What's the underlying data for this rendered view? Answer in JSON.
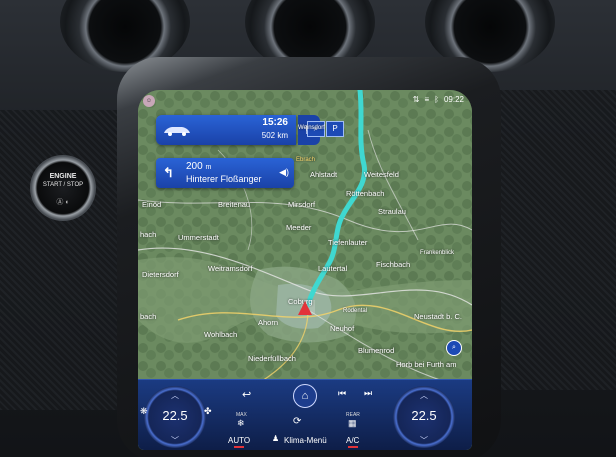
{
  "status": {
    "time": "09:22"
  },
  "route": {
    "eta": "15:26",
    "remaining": "502 km"
  },
  "guidance": {
    "distance": "200",
    "unit": "m",
    "street": "Hinterer Floßanger"
  },
  "map_labels": {
    "ebrach": "Ebrach",
    "ahlstadt": "Ahlstadt",
    "weitesfeld": "Weitesfeld",
    "roettenbach": "Röttenbach",
    "einod": "Einöd",
    "breitenau": "Breitenau",
    "mirsdorf": "Mirsdorf",
    "straulau": "Straulau",
    "hach": "hach",
    "ummerstadt": "Ummerstadt",
    "meeder": "Meeder",
    "tiefenlauter": "Tiefenlauter",
    "weitramsdorf": "Weitramsdorf",
    "lautertal": "Lautertal",
    "fischbach": "Fischbach",
    "frankenblick": "Frankenblick",
    "dietersdorf": "Dietersdorf",
    "coburg": "Coburg",
    "rodental": "Rodental",
    "neustadt": "Neustadt b. C.",
    "bach": "bach",
    "wohlbach": "Wohlbach",
    "ahorn": "Ahorn",
    "neuhof": "Neuhof",
    "niederfuellbach": "Niederfüllbach",
    "bluemenrod": "Blumenrod",
    "horb": "Horb bei Furth am",
    "weinsdorf": "Weinsdorf"
  },
  "climate": {
    "left_temp": "22.5",
    "right_temp": "22.5",
    "auto_label": "AUTO",
    "menu_label": "Klima-Menü",
    "ac_label": "A/C",
    "max_label": "MAX",
    "rear_label": "REAR"
  },
  "engine": {
    "line1": "ENGINE",
    "line2": "START / STOP"
  },
  "colors": {
    "route": "#3fd8d0",
    "card": "#1f4fc1",
    "location": "#e2333a",
    "bar": "#14306e"
  }
}
